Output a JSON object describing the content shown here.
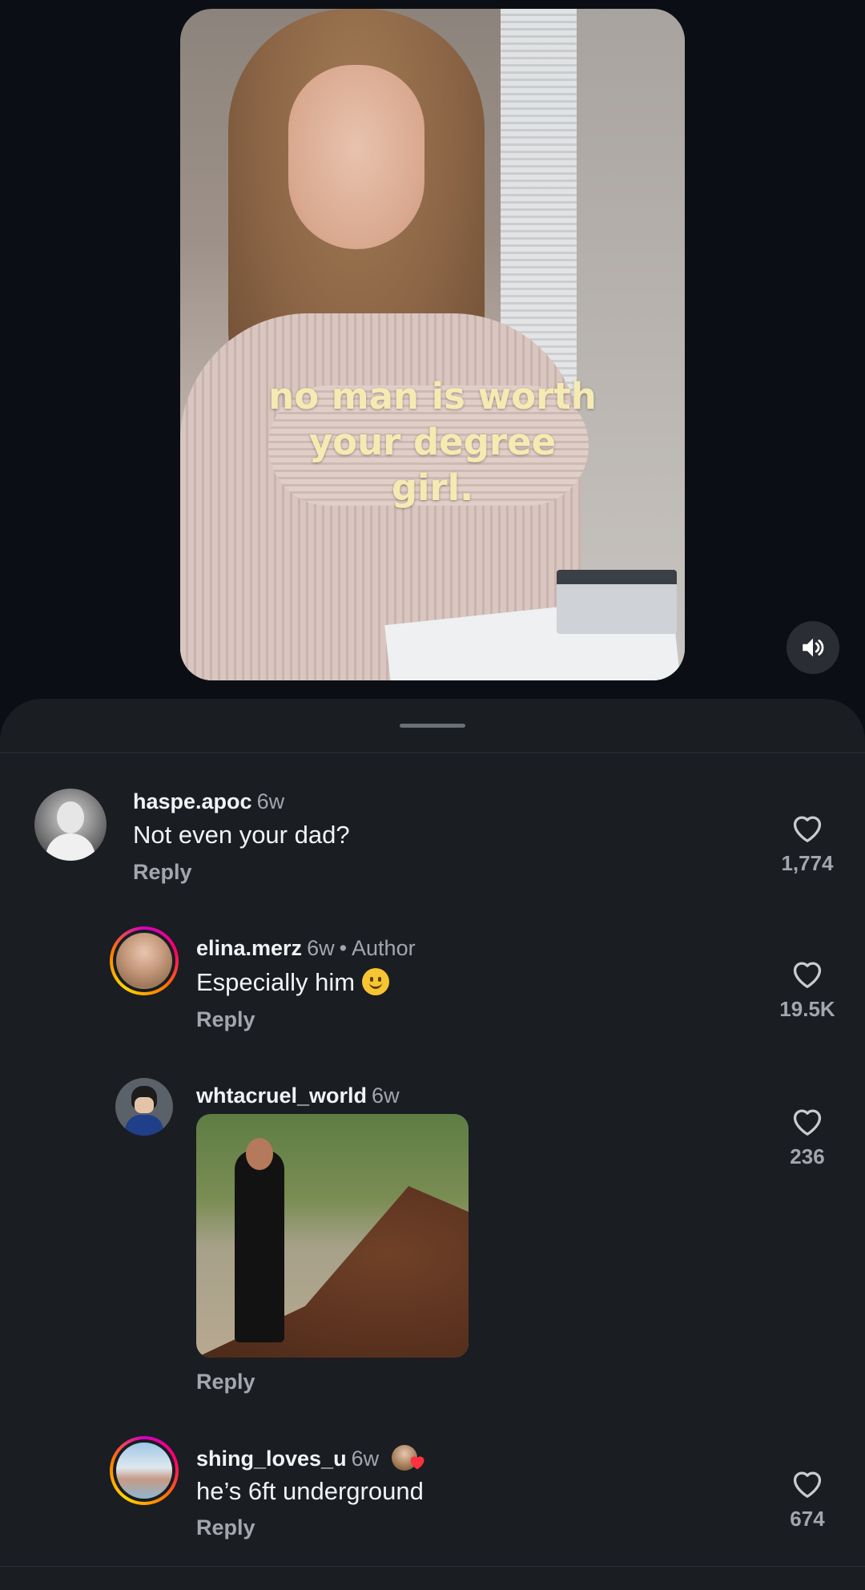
{
  "post": {
    "caption_lines": [
      "no man is worth",
      "your degree",
      "girl."
    ],
    "sound_icon": "speaker-icon"
  },
  "comments": [
    {
      "username": "haspe.apoc",
      "time": "6w",
      "text": "Not even your dad?",
      "reply_label": "Reply",
      "likes": "1,774"
    },
    {
      "username": "elina.merz",
      "time": "6w",
      "badge": "Author",
      "text": "Especially him",
      "reply_label": "Reply",
      "likes": "19.5K"
    },
    {
      "username": "whtacruel_world",
      "time": "6w",
      "reply_label": "Reply",
      "likes": "236"
    },
    {
      "username": "shing_loves_u",
      "time": "6w",
      "text": "he’s 6ft underground",
      "reply_label": "Reply",
      "likes": "674"
    }
  ],
  "colors": {
    "background": "#0b0f15",
    "sheet": "#1a1d22",
    "caption": "#f5ebb2",
    "muted": "#a3a7ad",
    "heart": "#ff3040"
  }
}
